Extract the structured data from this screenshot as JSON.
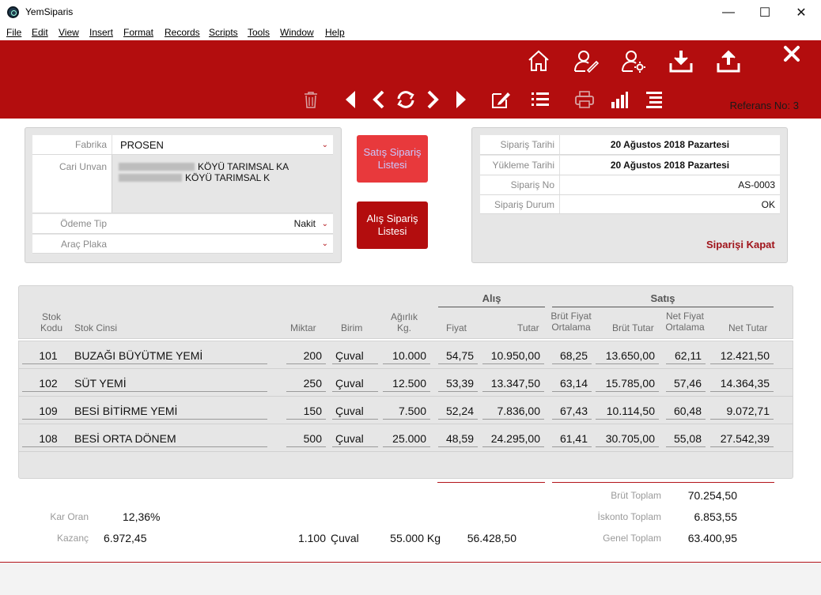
{
  "window": {
    "title": "YemSiparis",
    "minimize": "—",
    "maximize": "☐",
    "close": "✕"
  },
  "menu": [
    "File",
    "Edit",
    "View",
    "Insert",
    "Format",
    "Records",
    "Scripts",
    "Tools",
    "Window",
    "Help"
  ],
  "toolbar": {
    "reference": "Referans No: 3",
    "accent": "#b30d0e",
    "icons_top": [
      "home-icon",
      "user-edit-icon",
      "user-settings-icon",
      "download-icon",
      "upload-icon",
      "close-icon"
    ],
    "icons_bottom": [
      "trash-icon",
      "first-icon",
      "prev-icon",
      "refresh-icon",
      "next-icon",
      "last-icon",
      "edit-icon",
      "list-icon",
      "print-icon",
      "chart-icon",
      "align-icon"
    ]
  },
  "left_form": {
    "fabrika_label": "Fabrika",
    "fabrika_value": "PROSEN",
    "cari_unvan_label": "Cari Unvan",
    "cari_line1": "KÖYÜ TARIMSAL KA",
    "cari_line2": "KÖYÜ TARIMSAL  K",
    "odeme_tip_label": "Ödeme Tip",
    "odeme_tip_value": "Nakit",
    "arac_plaka_label": "Araç Plaka",
    "arac_plaka_value": ""
  },
  "buttons": {
    "satis_listesi": "Satış Sipariş Listesi",
    "alis_listesi": "Alış Sipariş Listesi"
  },
  "right_form": {
    "siparis_tarihi_label": "Sipariş Tarihi",
    "siparis_tarihi_value": "20 Ağustos 2018 Pazartesi",
    "yukleme_tarihi_label": "Yükleme Tarihi",
    "yukleme_tarihi_value": "20 Ağustos 2018 Pazartesi",
    "siparis_no_label": "Sipariş No",
    "siparis_no_value": "AS-0003",
    "siparis_durum_label": "Sipariş Durum",
    "siparis_durum_value": "OK",
    "kapat": "Siparişi Kapat"
  },
  "grid": {
    "group_alis": "Alış",
    "group_satis": "Satış",
    "headers": {
      "stok_kodu": "Stok\nKodu",
      "stok_cinsi": "Stok Cinsi",
      "miktar": "Miktar",
      "birim": "Birim",
      "agirlik": "Ağırlık\nKg.",
      "fiyat": "Fiyat",
      "tutar": "Tutar",
      "brut_fiyat": "Brüt Fiyat\nOrtalama",
      "brut_tutar": "Brüt Tutar",
      "net_fiyat": "Net Fiyat\nOrtalama",
      "net_tutar": "Net Tutar"
    },
    "rows": [
      {
        "kod": "101",
        "cins": "BUZAĞI BÜYÜTME YEMİ",
        "miktar": "200",
        "birim": "Çuval",
        "agirlik": "10.000",
        "fiyat": "54,75",
        "tutar": "10.950,00",
        "brut_fiyat": "68,25",
        "brut_tutar": "13.650,00",
        "net_fiyat": "62,11",
        "net_tutar": "12.421,50"
      },
      {
        "kod": "102",
        "cins": "SÜT YEMİ",
        "miktar": "250",
        "birim": "Çuval",
        "agirlik": "12.500",
        "fiyat": "53,39",
        "tutar": "13.347,50",
        "brut_fiyat": "63,14",
        "brut_tutar": "15.785,00",
        "net_fiyat": "57,46",
        "net_tutar": "14.364,35"
      },
      {
        "kod": "109",
        "cins": "BESİ BİTİRME YEMİ",
        "miktar": "150",
        "birim": "Çuval",
        "agirlik": "7.500",
        "fiyat": "52,24",
        "tutar": "7.836,00",
        "brut_fiyat": "67,43",
        "brut_tutar": "10.114,50",
        "net_fiyat": "60,48",
        "net_tutar": "9.072,71"
      },
      {
        "kod": "108",
        "cins": "BESİ ORTA DÖNEM",
        "miktar": "500",
        "birim": "Çuval",
        "agirlik": "25.000",
        "fiyat": "48,59",
        "tutar": "24.295,00",
        "brut_fiyat": "61,41",
        "brut_tutar": "30.705,00",
        "net_fiyat": "55,08",
        "net_tutar": "27.542,39"
      }
    ]
  },
  "summary": {
    "kar_oran_label": "Kar Oran",
    "kar_oran_value": "12,36%",
    "kazanc_label": "Kazanç",
    "kazanc_value": "6.972,45",
    "total_miktar": "1.100",
    "total_birim": "Çuval",
    "total_agirlik": "55.000 Kg",
    "total_alis": "56.428,50",
    "brut_toplam_label": "Brüt Toplam",
    "brut_toplam_value": "70.254,50",
    "iskonto_label": "İskonto Toplam",
    "iskonto_value": "6.853,55",
    "genel_label": "Genel Toplam",
    "genel_value": "63.400,95"
  }
}
